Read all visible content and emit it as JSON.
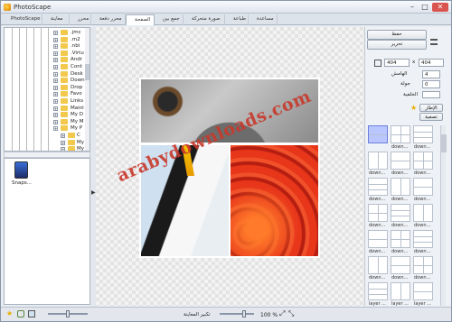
{
  "window": {
    "title": "PhotoScape"
  },
  "tabs": [
    {
      "label": "PhotoScape",
      "color": "#e59b2d"
    },
    {
      "label": "معاينة",
      "color": "#4a8fd6"
    },
    {
      "label": "محرر",
      "color": "#3a7bd5"
    },
    {
      "label": "محرر دفعة",
      "color": "#5aa04a"
    },
    {
      "label": "الصفحة",
      "color": "#d64a4a"
    },
    {
      "label": "جمع بين",
      "color": "#7a5ad6"
    },
    {
      "label": "صورة متحركة",
      "color": "#4aa0a0"
    },
    {
      "label": "طباعة",
      "color": "#c07a3a"
    },
    {
      "label": "مساعدة",
      "color": "#d63a3a"
    }
  ],
  "tree": {
    "items": [
      ".jmc",
      ".m2",
      ".nbi",
      ".Virtu",
      "Andr",
      "Cont",
      "Desk",
      "Down",
      "Drop",
      "Favo",
      "Links",
      "Mainl",
      "My D",
      "My M",
      "My P",
      "C",
      "My M",
      "My V"
    ]
  },
  "thumbs": {
    "caption": "Snaps..."
  },
  "right": {
    "save": "حفظ",
    "edit": "تحرير",
    "width": "404",
    "height": "404",
    "margin_label": "الهامش",
    "margin": "4",
    "round_label": "جولة",
    "round": "0",
    "bg_label": "الخلفية",
    "frame_btn": "الإطار",
    "filter_btn": "تصفية",
    "templates": [
      "",
      "down...",
      "down...",
      "down...",
      "down...",
      "down...",
      "down...",
      "down...",
      "down...",
      "down...",
      "down...",
      "down...",
      "down...",
      "down...",
      "down...",
      "down...",
      "down...",
      "down...",
      "layer ...",
      "layer ...",
      "layer ..."
    ]
  },
  "watermark": "arabydownloads.com",
  "status": {
    "preview_label": "تكبير المعاينة",
    "zoom": "100 %",
    "preview_level": 0.72,
    "left_slider_level": 0.5
  }
}
